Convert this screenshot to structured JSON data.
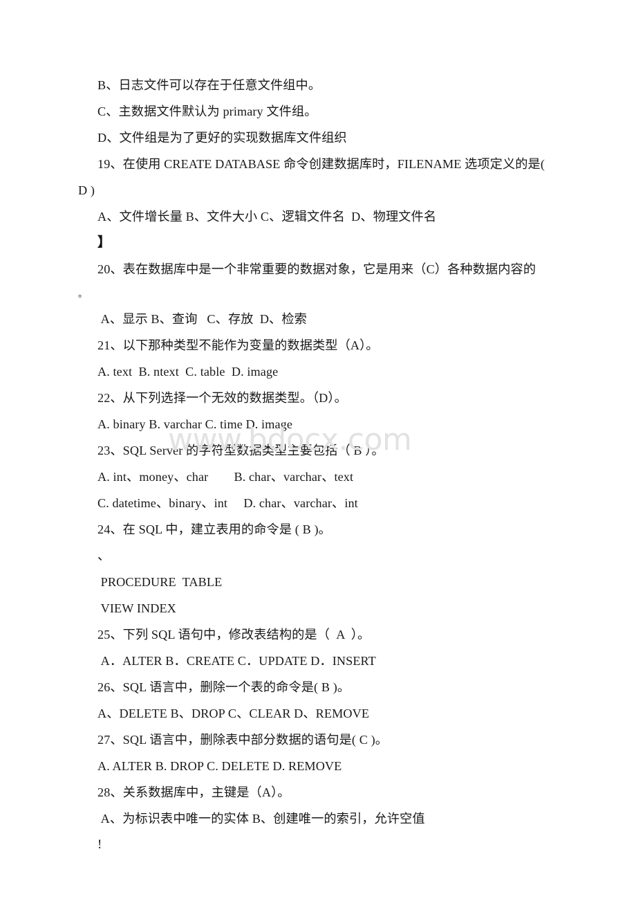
{
  "document": {
    "background_color": "#ffffff",
    "text_color": "#1a1a1a",
    "watermark": {
      "text": "www.bdocx.com",
      "color": "#e2e2e2"
    },
    "lines": [
      {
        "id": "l01",
        "text": "B、日志文件可以存在于任意文件组中。"
      },
      {
        "id": "l02",
        "text": "C、主数据文件默认为 primary 文件组。"
      },
      {
        "id": "l03",
        "text": "D、文件组是为了更好的实现数据库文件组织"
      },
      {
        "id": "l04",
        "text": "19、在使用 CREATE DATABASE 命令创建数据库时，FILENAME 选项定义的是("
      },
      {
        "id": "l05",
        "text": "D )"
      },
      {
        "id": "l06",
        "text": "A、文件增长量 B、文件大小 C、逻辑文件名  D、物理文件名"
      },
      {
        "id": "l07",
        "text": "】"
      },
      {
        "id": "l08",
        "text": "20、表在数据库中是一个非常重要的数据对象，它是用来（C）各种数据内容的"
      },
      {
        "id": "l09",
        "text": "。"
      },
      {
        "id": "l10",
        "text": " A、显示 B、查询   C、存放  D、检索"
      },
      {
        "id": "l11",
        "text": "21、以下那种类型不能作为变量的数据类型（A）。"
      },
      {
        "id": "l12",
        "text": "A. text  B. ntext  C. table  D. image"
      },
      {
        "id": "l13",
        "text": "22、从下列选择一个无效的数据类型。（D）。"
      },
      {
        "id": "l14",
        "text": "A. binary B. varchar C. time D. image"
      },
      {
        "id": "l15",
        "text": "23、SQL Server 的字符型数据类型主要包括（ B ）。"
      },
      {
        "id": "l16",
        "text": "A. int、money、char        B. char、varchar、text"
      },
      {
        "id": "l17",
        "text": "C. datetime、binary、int     D. char、varchar、int"
      },
      {
        "id": "l18",
        "text": "24、在 SQL 中，建立表用的命令是 ( B )。"
      },
      {
        "id": "l19",
        "text": "、"
      },
      {
        "id": "l20",
        "text": " PROCEDURE  TABLE"
      },
      {
        "id": "l21",
        "text": " VIEW INDEX"
      },
      {
        "id": "l22",
        "text": "25、下列 SQL 语句中，修改表结构的是（  A  ）。"
      },
      {
        "id": "l23",
        "text": " A．ALTER B．CREATE C．UPDATE D．INSERT"
      },
      {
        "id": "l24",
        "text": "26、SQL 语言中，删除一个表的命令是( B )。"
      },
      {
        "id": "l25",
        "text": "A、DELETE B、DROP C、CLEAR D、REMOVE"
      },
      {
        "id": "l26",
        "text": "27、SQL 语言中，删除表中部分数据的语句是( C )。"
      },
      {
        "id": "l27",
        "text": "A. ALTER B. DROP C. DELETE D. REMOVE"
      },
      {
        "id": "l28",
        "text": "28、关系数据库中，主键是（A）。"
      },
      {
        "id": "l29",
        "text": " A、为标识表中唯一的实体 B、创建唯一的索引，允许空值"
      },
      {
        "id": "l30",
        "text": "!"
      }
    ]
  }
}
